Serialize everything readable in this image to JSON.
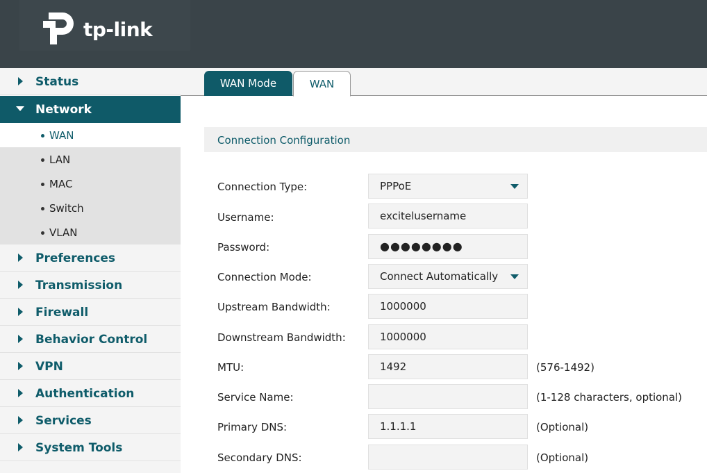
{
  "brand": {
    "name": "tp-link"
  },
  "sidebar": {
    "items": [
      {
        "label": "Status"
      },
      {
        "label": "Network"
      },
      {
        "label": "Preferences"
      },
      {
        "label": "Transmission"
      },
      {
        "label": "Firewall"
      },
      {
        "label": "Behavior Control"
      },
      {
        "label": "VPN"
      },
      {
        "label": "Authentication"
      },
      {
        "label": "Services"
      },
      {
        "label": "System Tools"
      }
    ],
    "network_sub": [
      {
        "label": "WAN"
      },
      {
        "label": "LAN"
      },
      {
        "label": "MAC"
      },
      {
        "label": "Switch"
      },
      {
        "label": "VLAN"
      }
    ],
    "active_item": "Network",
    "active_sub": "WAN"
  },
  "tabs": [
    {
      "label": "WAN Mode"
    },
    {
      "label": "WAN"
    }
  ],
  "section": {
    "title": "Connection Configuration"
  },
  "form": {
    "connection_type": {
      "label": "Connection Type:",
      "value": "PPPoE"
    },
    "username": {
      "label": "Username:",
      "value": "excitelusername"
    },
    "password": {
      "label": "Password:",
      "value": "●●●●●●●●"
    },
    "connection_mode": {
      "label": "Connection Mode:",
      "value": "Connect Automatically"
    },
    "upstream": {
      "label": "Upstream Bandwidth:",
      "value": "1000000"
    },
    "downstream": {
      "label": "Downstream Bandwidth:",
      "value": "1000000"
    },
    "mtu": {
      "label": "MTU:",
      "value": "1492",
      "hint": "(576-1492)"
    },
    "service_name": {
      "label": "Service Name:",
      "value": "",
      "hint": "(1-128 characters, optional)"
    },
    "primary_dns": {
      "label": "Primary DNS:",
      "value": "1.1.1.1",
      "hint": "(Optional)"
    },
    "secondary_dns": {
      "label": "Secondary DNS:",
      "value": "",
      "hint": "(Optional)"
    }
  },
  "colors": {
    "header_bg": "#3a4449",
    "accent": "#0f5a68",
    "sidebar_bg": "#f4f4f4",
    "subnav_bg": "#e2e2e2"
  }
}
